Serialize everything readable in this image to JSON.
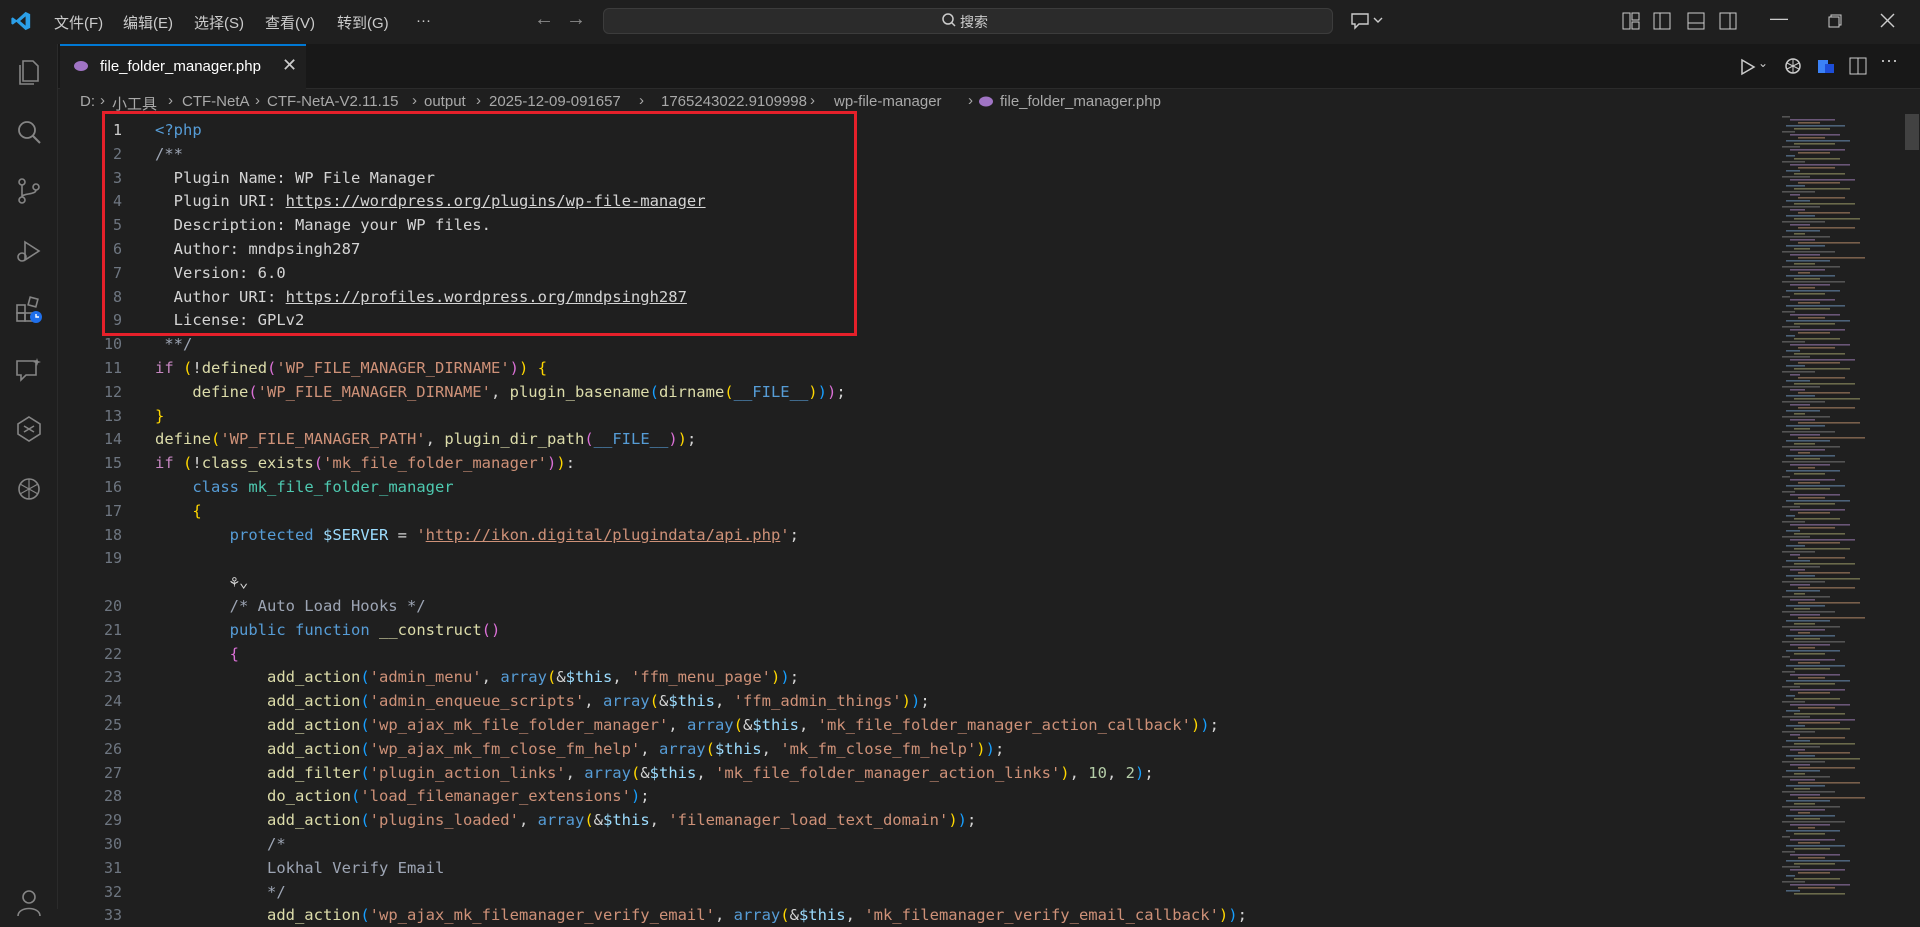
{
  "titlebar": {
    "menus": [
      "文件(F)",
      "编辑(E)",
      "选择(S)",
      "查看(V)",
      "转到(G)",
      "···"
    ],
    "search_placeholder": "搜索"
  },
  "tab": {
    "label": "file_folder_manager.php"
  },
  "breadcrumb": [
    "D:",
    "小工具",
    "CTF-NetA",
    "CTF-NetA-V2.11.15",
    "output",
    "2025-12-09-091657",
    "1765243022.9109998",
    "wp-file-manager",
    "file_folder_manager.php"
  ],
  "editor": {
    "lines": [
      {
        "n": "1",
        "segs": [
          {
            "c": "kw2",
            "t": "<?php"
          }
        ]
      },
      {
        "n": "2",
        "segs": [
          {
            "c": "cmt",
            "t": "/**"
          }
        ]
      },
      {
        "n": "3",
        "segs": [
          {
            "c": "plain",
            "t": "  Plugin Name: WP File Manager"
          }
        ]
      },
      {
        "n": "4",
        "segs": [
          {
            "c": "plain",
            "t": "  Plugin URI: "
          },
          {
            "c": "plain ul",
            "t": "https://wordpress.org/plugins/wp-file-manager"
          }
        ]
      },
      {
        "n": "5",
        "segs": [
          {
            "c": "plain",
            "t": "  Description: Manage your WP files."
          }
        ]
      },
      {
        "n": "6",
        "segs": [
          {
            "c": "plain",
            "t": "  Author: mndpsingh287"
          }
        ]
      },
      {
        "n": "7",
        "segs": [
          {
            "c": "plain",
            "t": "  Version: 6.0"
          }
        ]
      },
      {
        "n": "8",
        "segs": [
          {
            "c": "plain",
            "t": "  Author URI: "
          },
          {
            "c": "plain ul",
            "t": "https://profiles.wordpress.org/mndpsingh287"
          }
        ]
      },
      {
        "n": "9",
        "segs": [
          {
            "c": "plain",
            "t": "  License: GPLv2"
          }
        ]
      },
      {
        "n": "10",
        "segs": [
          {
            "c": "cmt",
            "t": " **/"
          }
        ]
      },
      {
        "n": "11",
        "segs": [
          {
            "c": "kw",
            "t": "if"
          },
          {
            "c": "plain",
            "t": " "
          },
          {
            "c": "br1",
            "t": "("
          },
          {
            "c": "plain",
            "t": "!"
          },
          {
            "c": "fn",
            "t": "defined"
          },
          {
            "c": "br2",
            "t": "("
          },
          {
            "c": "str",
            "t": "'WP_FILE_MANAGER_DIRNAME'"
          },
          {
            "c": "br2",
            "t": ")"
          },
          {
            "c": "br1",
            "t": ")"
          },
          {
            "c": "plain",
            "t": " "
          },
          {
            "c": "br1",
            "t": "{"
          }
        ]
      },
      {
        "n": "12",
        "segs": [
          {
            "c": "plain",
            "t": "    "
          },
          {
            "c": "fn",
            "t": "define"
          },
          {
            "c": "br2",
            "t": "("
          },
          {
            "c": "str",
            "t": "'WP_FILE_MANAGER_DIRNAME'"
          },
          {
            "c": "plain",
            "t": ", "
          },
          {
            "c": "fn",
            "t": "plugin_basename"
          },
          {
            "c": "br3",
            "t": "("
          },
          {
            "c": "fn",
            "t": "dirname"
          },
          {
            "c": "br1",
            "t": "("
          },
          {
            "c": "kw2",
            "t": "__FILE__"
          },
          {
            "c": "br1",
            "t": ")"
          },
          {
            "c": "br3",
            "t": ")"
          },
          {
            "c": "br2",
            "t": ")"
          },
          {
            "c": "plain",
            "t": ";"
          }
        ]
      },
      {
        "n": "13",
        "segs": [
          {
            "c": "br1",
            "t": "}"
          }
        ]
      },
      {
        "n": "14",
        "segs": [
          {
            "c": "fn",
            "t": "define"
          },
          {
            "c": "br1",
            "t": "("
          },
          {
            "c": "str",
            "t": "'WP_FILE_MANAGER_PATH'"
          },
          {
            "c": "plain",
            "t": ", "
          },
          {
            "c": "fn",
            "t": "plugin_dir_path"
          },
          {
            "c": "br2",
            "t": "("
          },
          {
            "c": "kw2",
            "t": "__FILE__"
          },
          {
            "c": "br2",
            "t": ")"
          },
          {
            "c": "br1",
            "t": ")"
          },
          {
            "c": "plain",
            "t": ";"
          }
        ]
      },
      {
        "n": "15",
        "segs": [
          {
            "c": "kw",
            "t": "if"
          },
          {
            "c": "plain",
            "t": " "
          },
          {
            "c": "br1",
            "t": "("
          },
          {
            "c": "plain",
            "t": "!"
          },
          {
            "c": "fn",
            "t": "class_exists"
          },
          {
            "c": "br2",
            "t": "("
          },
          {
            "c": "str",
            "t": "'mk_file_folder_manager'"
          },
          {
            "c": "br2",
            "t": ")"
          },
          {
            "c": "br1",
            "t": ")"
          },
          {
            "c": "plain",
            "t": ":"
          }
        ]
      },
      {
        "n": "16",
        "segs": [
          {
            "c": "plain",
            "t": "    "
          },
          {
            "c": "kw2",
            "t": "class"
          },
          {
            "c": "plain",
            "t": " "
          },
          {
            "c": "cls",
            "t": "mk_file_folder_manager"
          }
        ]
      },
      {
        "n": "17",
        "segs": [
          {
            "c": "plain",
            "t": "    "
          },
          {
            "c": "br1",
            "t": "{"
          }
        ]
      },
      {
        "n": "18",
        "segs": [
          {
            "c": "plain",
            "t": "        "
          },
          {
            "c": "kw2",
            "t": "protected"
          },
          {
            "c": "plain",
            "t": " "
          },
          {
            "c": "var",
            "t": "$SERVER"
          },
          {
            "c": "plain",
            "t": " = "
          },
          {
            "c": "str",
            "t": "'"
          },
          {
            "c": "str ul",
            "t": "http://ikon.digital/plugindata/api.php"
          },
          {
            "c": "str",
            "t": "'"
          },
          {
            "c": "plain",
            "t": ";"
          }
        ]
      },
      {
        "n": "19",
        "segs": []
      },
      {
        "n": "",
        "segs": [
          {
            "c": "plain",
            "t": "        ⚘⌄"
          }
        ]
      },
      {
        "n": "20",
        "segs": [
          {
            "c": "plain",
            "t": "        "
          },
          {
            "c": "cmt",
            "t": "/* Auto Load Hooks */"
          }
        ]
      },
      {
        "n": "21",
        "segs": [
          {
            "c": "plain",
            "t": "        "
          },
          {
            "c": "kw2",
            "t": "public"
          },
          {
            "c": "plain",
            "t": " "
          },
          {
            "c": "kw2",
            "t": "function"
          },
          {
            "c": "plain",
            "t": " "
          },
          {
            "c": "fn",
            "t": "__construct"
          },
          {
            "c": "br2",
            "t": "()"
          }
        ]
      },
      {
        "n": "22",
        "segs": [
          {
            "c": "plain",
            "t": "        "
          },
          {
            "c": "br2",
            "t": "{"
          }
        ]
      },
      {
        "n": "23",
        "segs": [
          {
            "c": "plain",
            "t": "            "
          },
          {
            "c": "fn",
            "t": "add_action"
          },
          {
            "c": "br3",
            "t": "("
          },
          {
            "c": "str",
            "t": "'admin_menu'"
          },
          {
            "c": "plain",
            "t": ", "
          },
          {
            "c": "kw2",
            "t": "array"
          },
          {
            "c": "br1",
            "t": "("
          },
          {
            "c": "plain",
            "t": "&"
          },
          {
            "c": "var",
            "t": "$this"
          },
          {
            "c": "plain",
            "t": ", "
          },
          {
            "c": "str",
            "t": "'ffm_menu_page'"
          },
          {
            "c": "br1",
            "t": ")"
          },
          {
            "c": "br3",
            "t": ")"
          },
          {
            "c": "plain",
            "t": ";"
          }
        ]
      },
      {
        "n": "24",
        "segs": [
          {
            "c": "plain",
            "t": "            "
          },
          {
            "c": "fn",
            "t": "add_action"
          },
          {
            "c": "br3",
            "t": "("
          },
          {
            "c": "str",
            "t": "'admin_enqueue_scripts'"
          },
          {
            "c": "plain",
            "t": ", "
          },
          {
            "c": "kw2",
            "t": "array"
          },
          {
            "c": "br1",
            "t": "("
          },
          {
            "c": "plain",
            "t": "&"
          },
          {
            "c": "var",
            "t": "$this"
          },
          {
            "c": "plain",
            "t": ", "
          },
          {
            "c": "str",
            "t": "'ffm_admin_things'"
          },
          {
            "c": "br1",
            "t": ")"
          },
          {
            "c": "br3",
            "t": ")"
          },
          {
            "c": "plain",
            "t": ";"
          }
        ]
      },
      {
        "n": "25",
        "segs": [
          {
            "c": "plain",
            "t": "            "
          },
          {
            "c": "fn",
            "t": "add_action"
          },
          {
            "c": "br3",
            "t": "("
          },
          {
            "c": "str",
            "t": "'wp_ajax_mk_file_folder_manager'"
          },
          {
            "c": "plain",
            "t": ", "
          },
          {
            "c": "kw2",
            "t": "array"
          },
          {
            "c": "br1",
            "t": "("
          },
          {
            "c": "plain",
            "t": "&"
          },
          {
            "c": "var",
            "t": "$this"
          },
          {
            "c": "plain",
            "t": ", "
          },
          {
            "c": "str",
            "t": "'mk_file_folder_manager_action_callback'"
          },
          {
            "c": "br1",
            "t": ")"
          },
          {
            "c": "br3",
            "t": ")"
          },
          {
            "c": "plain",
            "t": ";"
          }
        ]
      },
      {
        "n": "26",
        "segs": [
          {
            "c": "plain",
            "t": "            "
          },
          {
            "c": "fn",
            "t": "add_action"
          },
          {
            "c": "br3",
            "t": "("
          },
          {
            "c": "str",
            "t": "'wp_ajax_mk_fm_close_fm_help'"
          },
          {
            "c": "plain",
            "t": ", "
          },
          {
            "c": "kw2",
            "t": "array"
          },
          {
            "c": "br1",
            "t": "("
          },
          {
            "c": "var",
            "t": "$this"
          },
          {
            "c": "plain",
            "t": ", "
          },
          {
            "c": "str",
            "t": "'mk_fm_close_fm_help'"
          },
          {
            "c": "br1",
            "t": ")"
          },
          {
            "c": "br3",
            "t": ")"
          },
          {
            "c": "plain",
            "t": ";"
          }
        ]
      },
      {
        "n": "27",
        "segs": [
          {
            "c": "plain",
            "t": "            "
          },
          {
            "c": "fn",
            "t": "add_filter"
          },
          {
            "c": "br3",
            "t": "("
          },
          {
            "c": "str",
            "t": "'plugin_action_links'"
          },
          {
            "c": "plain",
            "t": ", "
          },
          {
            "c": "kw2",
            "t": "array"
          },
          {
            "c": "br1",
            "t": "("
          },
          {
            "c": "plain",
            "t": "&"
          },
          {
            "c": "var",
            "t": "$this"
          },
          {
            "c": "plain",
            "t": ", "
          },
          {
            "c": "str",
            "t": "'mk_file_folder_manager_action_links'"
          },
          {
            "c": "br1",
            "t": ")"
          },
          {
            "c": "plain",
            "t": ", "
          },
          {
            "c": "num",
            "t": "10"
          },
          {
            "c": "plain",
            "t": ", "
          },
          {
            "c": "num",
            "t": "2"
          },
          {
            "c": "br3",
            "t": ")"
          },
          {
            "c": "plain",
            "t": ";"
          }
        ]
      },
      {
        "n": "28",
        "segs": [
          {
            "c": "plain",
            "t": "            "
          },
          {
            "c": "fn",
            "t": "do_action"
          },
          {
            "c": "br3",
            "t": "("
          },
          {
            "c": "str",
            "t": "'load_filemanager_extensions'"
          },
          {
            "c": "br3",
            "t": ")"
          },
          {
            "c": "plain",
            "t": ";"
          }
        ]
      },
      {
        "n": "29",
        "segs": [
          {
            "c": "plain",
            "t": "            "
          },
          {
            "c": "fn",
            "t": "add_action"
          },
          {
            "c": "br3",
            "t": "("
          },
          {
            "c": "str",
            "t": "'plugins_loaded'"
          },
          {
            "c": "plain",
            "t": ", "
          },
          {
            "c": "kw2",
            "t": "array"
          },
          {
            "c": "br1",
            "t": "("
          },
          {
            "c": "plain",
            "t": "&"
          },
          {
            "c": "var",
            "t": "$this"
          },
          {
            "c": "plain",
            "t": ", "
          },
          {
            "c": "str",
            "t": "'filemanager_load_text_domain'"
          },
          {
            "c": "br1",
            "t": ")"
          },
          {
            "c": "br3",
            "t": ")"
          },
          {
            "c": "plain",
            "t": ";"
          }
        ]
      },
      {
        "n": "30",
        "segs": [
          {
            "c": "plain",
            "t": "            "
          },
          {
            "c": "cmt",
            "t": "/*"
          }
        ]
      },
      {
        "n": "31",
        "segs": [
          {
            "c": "plain",
            "t": "            "
          },
          {
            "c": "cmt",
            "t": "Lokhal Verify Email"
          }
        ]
      },
      {
        "n": "32",
        "segs": [
          {
            "c": "plain",
            "t": "            "
          },
          {
            "c": "cmt",
            "t": "*/"
          }
        ]
      },
      {
        "n": "33",
        "segs": [
          {
            "c": "plain",
            "t": "            "
          },
          {
            "c": "fn",
            "t": "add_action"
          },
          {
            "c": "br3",
            "t": "("
          },
          {
            "c": "str",
            "t": "'wp_ajax_mk_filemanager_verify_email'"
          },
          {
            "c": "plain",
            "t": ", "
          },
          {
            "c": "kw2",
            "t": "array"
          },
          {
            "c": "br1",
            "t": "("
          },
          {
            "c": "plain",
            "t": "&"
          },
          {
            "c": "var",
            "t": "$this"
          },
          {
            "c": "plain",
            "t": ", "
          },
          {
            "c": "str",
            "t": "'mk_filemanager_verify_email_callback'"
          },
          {
            "c": "br1",
            "t": ")"
          },
          {
            "c": "br3",
            "t": ")"
          },
          {
            "c": "plain",
            "t": ";"
          }
        ]
      }
    ]
  },
  "colors": {
    "accent": "#0078d4",
    "highlight_box": "#e5202a",
    "background": "#1f1f1f"
  }
}
